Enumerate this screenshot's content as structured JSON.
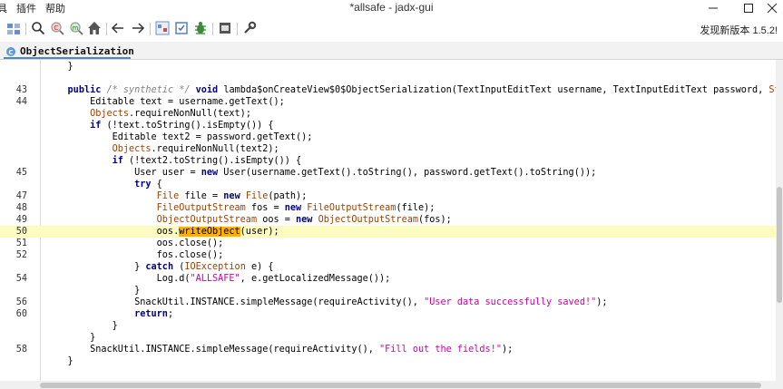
{
  "window": {
    "title": "*allsafe - jadx-gui",
    "menu": [
      "具",
      "插件",
      "帮助"
    ],
    "controls": [
      "minimize",
      "maximize",
      "close"
    ]
  },
  "toolbar": {
    "icons": [
      "open-project-icon",
      "search-icon",
      "search-class-icon",
      "search-usage-icon",
      "home-icon",
      "back-icon",
      "forward-icon",
      "deobfuscation-icon",
      "sync-icon",
      "decompile-icon",
      "log-icon",
      "settings-icon"
    ],
    "new_version": "发现新版本 1.5.2!"
  },
  "tab": {
    "label": "ObjectSerialization"
  },
  "code_lines": [
    {
      "n": "",
      "segs": [
        [
          "pl",
          "    }"
        ]
      ]
    },
    {
      "n": "",
      "segs": []
    },
    {
      "n": "43",
      "segs": [
        [
          "pl",
          "    "
        ],
        [
          "kw",
          "public"
        ],
        [
          "pl",
          " "
        ],
        [
          "cm",
          "/* synthetic */"
        ],
        [
          "pl",
          " "
        ],
        [
          "kw",
          "void"
        ],
        [
          "pl",
          " lambda$onCreateView$0$ObjectSerialization(TextInputEditText username, TextInputEditText password, "
        ],
        [
          "tp",
          "String"
        ],
        [
          "pl",
          " p"
        ]
      ]
    },
    {
      "n": "44",
      "segs": [
        [
          "pl",
          "        Editable text = username.getText();"
        ]
      ]
    },
    {
      "n": "",
      "segs": [
        [
          "pl",
          "        "
        ],
        [
          "tp",
          "Objects"
        ],
        [
          "pl",
          ".requireNonNull(text);"
        ]
      ]
    },
    {
      "n": "",
      "segs": [
        [
          "pl",
          "        "
        ],
        [
          "kw",
          "if"
        ],
        [
          "pl",
          " (!text.toString().isEmpty()) {"
        ]
      ]
    },
    {
      "n": "",
      "segs": [
        [
          "pl",
          "            Editable text2 = password.getText();"
        ]
      ]
    },
    {
      "n": "",
      "segs": [
        [
          "pl",
          "            "
        ],
        [
          "tp",
          "Objects"
        ],
        [
          "pl",
          ".requireNonNull(text2);"
        ]
      ]
    },
    {
      "n": "",
      "segs": [
        [
          "pl",
          "            "
        ],
        [
          "kw",
          "if"
        ],
        [
          "pl",
          " (!text2.toString().isEmpty()) {"
        ]
      ]
    },
    {
      "n": "45",
      "segs": [
        [
          "pl",
          "                User user = "
        ],
        [
          "kw",
          "new"
        ],
        [
          "pl",
          " User(username.getText().toString(), password.getText().toString());"
        ]
      ]
    },
    {
      "n": "",
      "segs": [
        [
          "pl",
          "                "
        ],
        [
          "kw",
          "try"
        ],
        [
          "pl",
          " {"
        ]
      ]
    },
    {
      "n": "47",
      "segs": [
        [
          "pl",
          "                    "
        ],
        [
          "tp",
          "File"
        ],
        [
          "pl",
          " file = "
        ],
        [
          "kw",
          "new"
        ],
        [
          "pl",
          " "
        ],
        [
          "tp",
          "File"
        ],
        [
          "pl",
          "(path);"
        ]
      ]
    },
    {
      "n": "48",
      "segs": [
        [
          "pl",
          "                    "
        ],
        [
          "tp",
          "FileOutputStream"
        ],
        [
          "pl",
          " fos = "
        ],
        [
          "kw",
          "new"
        ],
        [
          "pl",
          " "
        ],
        [
          "tp",
          "FileOutputStream"
        ],
        [
          "pl",
          "(file);"
        ]
      ]
    },
    {
      "n": "49",
      "segs": [
        [
          "pl",
          "                    "
        ],
        [
          "tp",
          "ObjectOutputStream"
        ],
        [
          "pl",
          " oos = "
        ],
        [
          "kw",
          "new"
        ],
        [
          "pl",
          " "
        ],
        [
          "tp",
          "ObjectOutputStream"
        ],
        [
          "pl",
          "(fos);"
        ]
      ]
    },
    {
      "n": "50",
      "hl": true,
      "segs": [
        [
          "pl",
          "                    oos."
        ],
        [
          "mark",
          "writeObject"
        ],
        [
          "pl",
          "(user);"
        ]
      ]
    },
    {
      "n": "51",
      "segs": [
        [
          "pl",
          "                    oos.close();"
        ]
      ]
    },
    {
      "n": "52",
      "segs": [
        [
          "pl",
          "                    fos.close();"
        ]
      ]
    },
    {
      "n": "",
      "segs": [
        [
          "pl",
          "                } "
        ],
        [
          "kw",
          "catch"
        ],
        [
          "pl",
          " ("
        ],
        [
          "tp",
          "IOException"
        ],
        [
          "pl",
          " e) {"
        ]
      ]
    },
    {
      "n": "54",
      "segs": [
        [
          "pl",
          "                    Log.d("
        ],
        [
          "st",
          "\"ALLSAFE\""
        ],
        [
          "pl",
          ", e.getLocalizedMessage());"
        ]
      ]
    },
    {
      "n": "",
      "segs": [
        [
          "pl",
          "                }"
        ]
      ]
    },
    {
      "n": "56",
      "segs": [
        [
          "pl",
          "                SnackUtil.INSTANCE.simpleMessage(requireActivity(), "
        ],
        [
          "st",
          "\"User data successfully saved!\""
        ],
        [
          "pl",
          ");"
        ]
      ]
    },
    {
      "n": "60",
      "segs": [
        [
          "pl",
          "                "
        ],
        [
          "kw",
          "return"
        ],
        [
          "pl",
          ";"
        ]
      ]
    },
    {
      "n": "",
      "segs": [
        [
          "pl",
          "            }"
        ]
      ]
    },
    {
      "n": "",
      "segs": [
        [
          "pl",
          "        }"
        ]
      ]
    },
    {
      "n": "58",
      "segs": [
        [
          "pl",
          "        SnackUtil.INSTANCE.simpleMessage(requireActivity(), "
        ],
        [
          "st",
          "\"Fill out the fields!\""
        ],
        [
          "pl",
          ");"
        ]
      ]
    },
    {
      "n": "",
      "segs": [
        [
          "pl",
          "    }"
        ]
      ]
    }
  ],
  "colors": {
    "keyword": "#000080",
    "type": "#a04000",
    "string": "#cc00aa",
    "comment": "#808080",
    "highlight_line": "#fcfcc0",
    "search_mark": "#ffb000"
  }
}
